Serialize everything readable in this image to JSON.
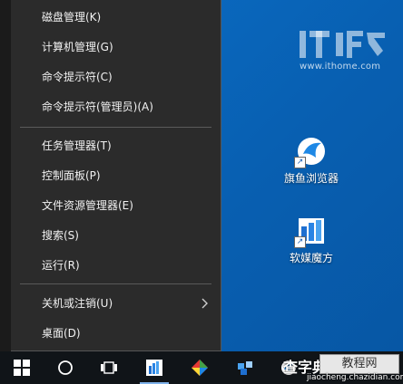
{
  "menu": {
    "items": [
      {
        "label": "磁盘管理(K)"
      },
      {
        "label": "计算机管理(G)"
      },
      {
        "label": "命令提示符(C)"
      },
      {
        "label": "命令提示符(管理员)(A)"
      },
      {
        "label": "任务管理器(T)"
      },
      {
        "label": "控制面板(P)"
      },
      {
        "label": "文件资源管理器(E)"
      },
      {
        "label": "搜索(S)"
      },
      {
        "label": "运行(R)"
      },
      {
        "label": "关机或注销(U)"
      },
      {
        "label": "桌面(D)"
      }
    ]
  },
  "desktop": {
    "icons": [
      {
        "label": "旗鱼浏览器",
        "icon": "qiyu-browser-icon"
      },
      {
        "label": "软媒魔方",
        "icon": "ruanmei-mofang-icon"
      }
    ],
    "watermark_text": "www.ithome.com"
  },
  "bottom_watermark": {
    "cn": "查字典",
    "box": "教程网",
    "url": "jiaocheng.chazidian.com"
  },
  "colors": {
    "desktop_blue": "#0a64b8",
    "menu_bg": "#2b2b2b",
    "taskbar_bg": "#101418"
  }
}
